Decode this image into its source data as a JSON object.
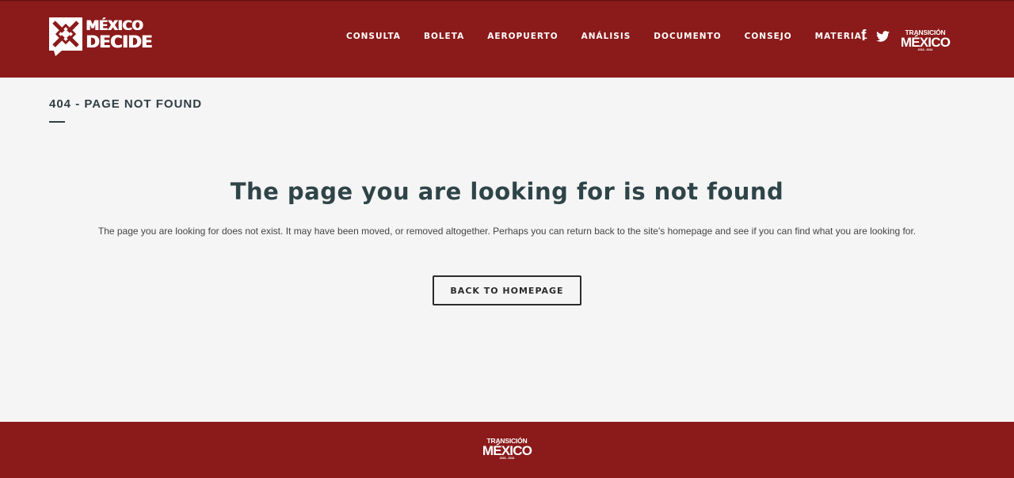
{
  "brand": {
    "logo_line1": "MÉXICO",
    "logo_line2": "DECIDE",
    "colors": {
      "primary": "#8b1a1a",
      "text_dark": "#2f3e44",
      "background": "#f5f5f5"
    }
  },
  "nav": {
    "items": [
      "CONSULTA",
      "BOLETA",
      "AEROPUERTO",
      "ANÁLISIS",
      "DOCUMENTO",
      "CONSEJO",
      "MATERIAL"
    ]
  },
  "social": {
    "facebook_icon": "facebook-icon",
    "twitter_icon": "twitter-icon"
  },
  "partner_logo": {
    "line1": "TRANSICIÓN",
    "line2": "MÉXICO",
    "line3": "2018 - 2024"
  },
  "page": {
    "title": "404 - PAGE NOT FOUND",
    "heading": "The page you are looking for is not found",
    "message": "The page you are looking for does not exist. It may have been moved, or removed altogether. Perhaps you can return back to the site's homepage and see if you can find what you are looking for.",
    "button_label": "BACK TO HOMEPAGE"
  }
}
